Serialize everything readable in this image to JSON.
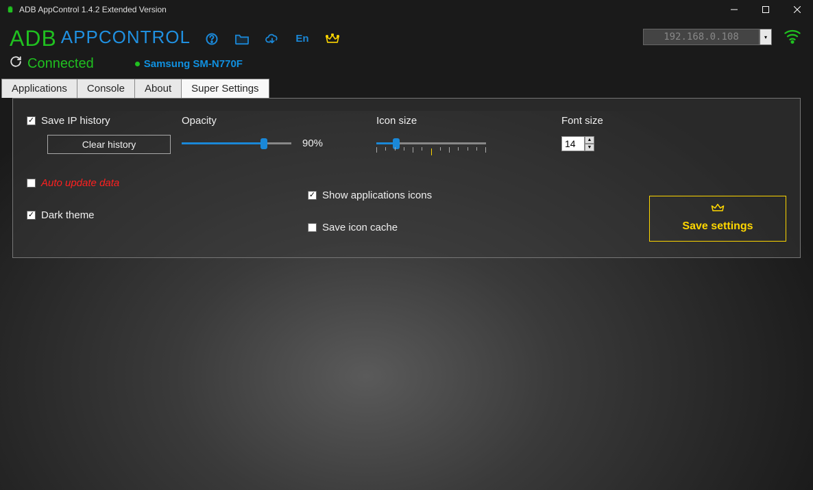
{
  "window": {
    "title": "ADB AppControl 1.4.2 Extended Version"
  },
  "logo": {
    "part1": "ADB",
    "part2": "APPCONTROL"
  },
  "ip": "192.168.0.108",
  "status": {
    "connected": "Connected",
    "device": "Samsung SM-N770F"
  },
  "tabs": [
    "Applications",
    "Console",
    "About",
    "Super Settings"
  ],
  "settings": {
    "save_ip_label": "Save IP history",
    "clear_history": "Clear history",
    "auto_update_label": "Auto update data",
    "dark_theme_label": "Dark theme",
    "opacity_label": "Opacity",
    "opacity_value": "90%",
    "opacity_percent": 75,
    "icon_size_label": "Icon size",
    "icon_size_percent": 18,
    "font_size_label": "Font size",
    "font_size_value": "14",
    "show_icons_label": "Show applications icons",
    "save_cache_label": "Save icon cache",
    "save_button": "Save settings",
    "save_ip_checked": true,
    "auto_update_checked": false,
    "dark_theme_checked": true,
    "show_icons_checked": true,
    "save_cache_checked": false
  },
  "colors": {
    "green": "#20c020",
    "blue": "#1a88d8",
    "gold": "#ffd700",
    "red": "#ff2020"
  }
}
